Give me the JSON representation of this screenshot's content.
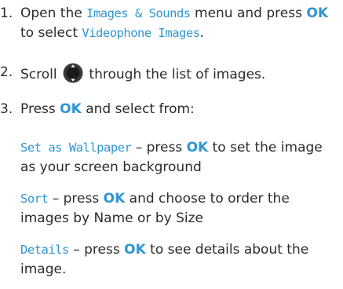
{
  "steps": [
    {
      "number": "1.",
      "t1": "Open the",
      "menu": "Images & Sounds",
      "t2": "menu and press",
      "key": "OK",
      "t3": "to select",
      "option": "Videophone Images",
      "t4": "."
    },
    {
      "number": "2.",
      "t1": "Scroll",
      "icon": "navigation-key-icon",
      "t2": "through the list of images."
    },
    {
      "number": "3.",
      "t1": "Press",
      "key": "OK",
      "t2": "and select from:"
    }
  ],
  "options": [
    {
      "label": "Set as Wallpaper",
      "t1": "– press",
      "key": "OK",
      "t2": "to set the image as your screen background"
    },
    {
      "label": "Sort",
      "t1": "– press",
      "key": "OK",
      "t2": "and choose to order the images by Name or by Size"
    },
    {
      "label": "Details",
      "t1": "– press",
      "key": "OK",
      "t2": "to see details about the image."
    }
  ],
  "colors": {
    "accent": "#2f95d1",
    "text": "#2b2b2b"
  }
}
